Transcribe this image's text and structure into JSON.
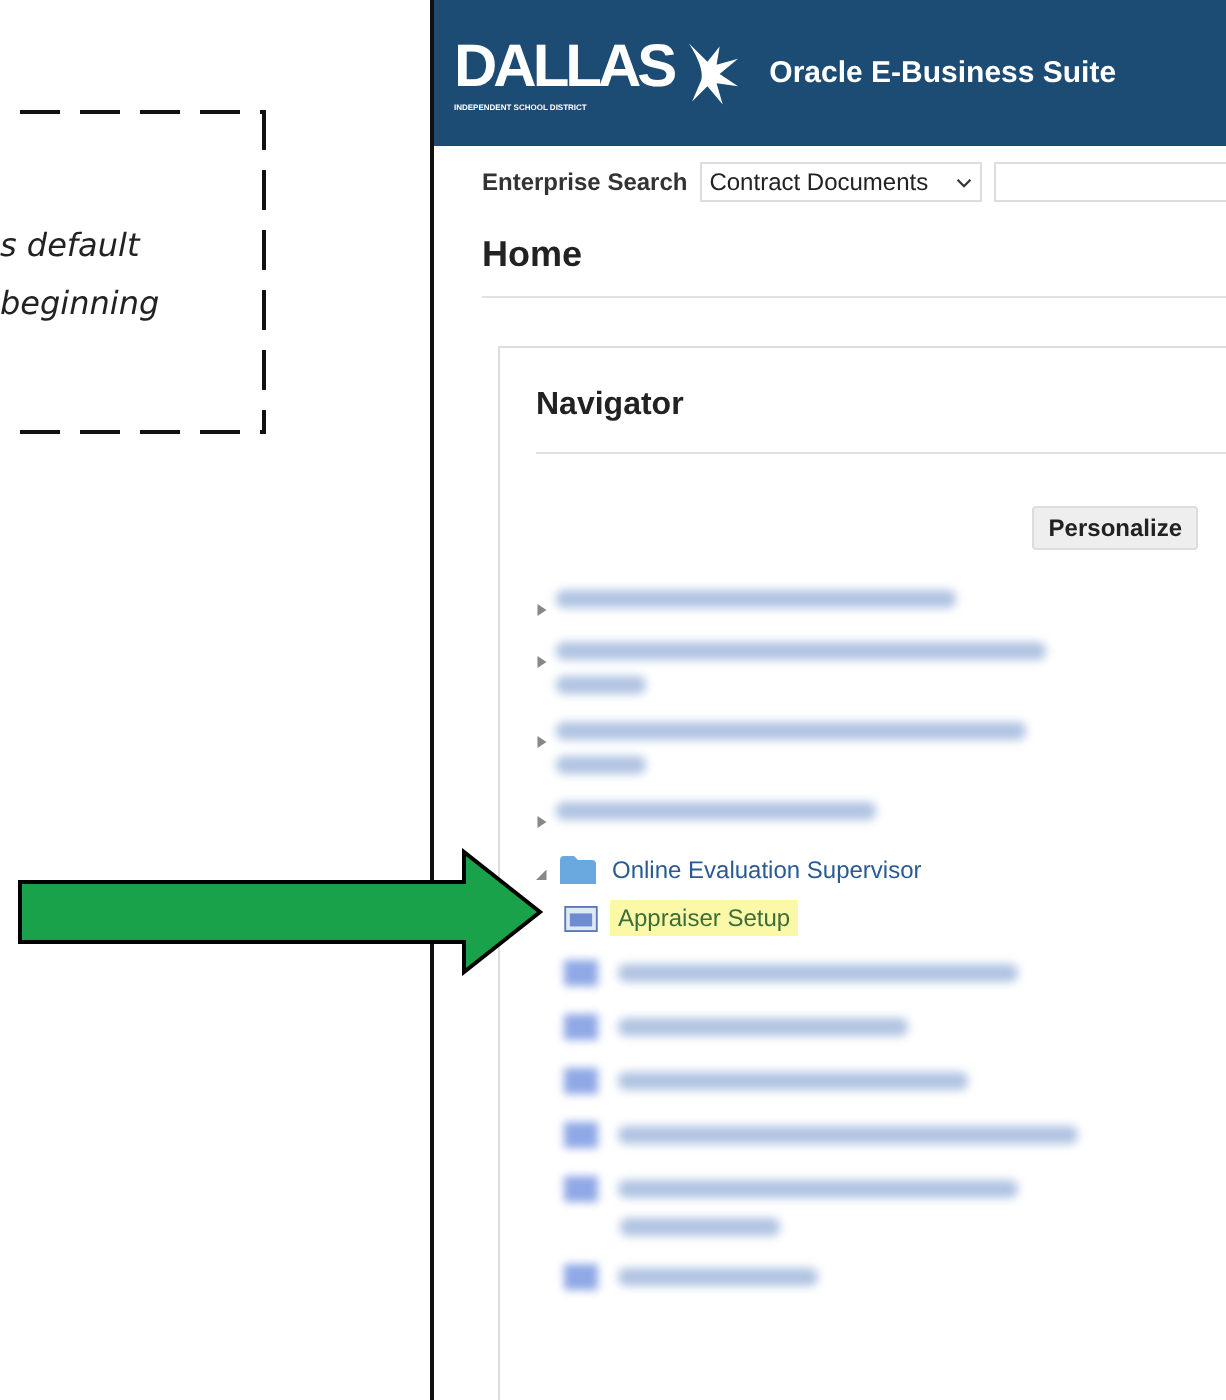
{
  "annotation": {
    "lines": [
      "s default",
      "beginning"
    ]
  },
  "header": {
    "logo": "DALLAS",
    "logo_subtitle": "INDEPENDENT SCHOOL DISTRICT",
    "title": "Oracle E-Business Suite"
  },
  "search": {
    "label": "Enterprise Search",
    "scope": "Contract Documents"
  },
  "page_title": "Home",
  "navigator": {
    "title": "Navigator",
    "personalize": "Personalize",
    "items": [
      {
        "kind": "blurred",
        "wrapped": false,
        "expanded": false
      },
      {
        "kind": "blurred",
        "wrapped": true,
        "expanded": false
      },
      {
        "kind": "blurred",
        "wrapped": true,
        "expanded": false
      },
      {
        "kind": "blurred",
        "wrapped": false,
        "expanded": false
      },
      {
        "kind": "folder",
        "label": "Online Evaluation Supervisor",
        "expanded": true,
        "children": [
          {
            "kind": "page",
            "label": "Appraiser Setup",
            "selected": true
          },
          {
            "kind": "blurred",
            "wrapped": false,
            "selected": false
          },
          {
            "kind": "blurred",
            "wrapped": false,
            "selected": false
          },
          {
            "kind": "blurred",
            "wrapped": false,
            "selected": false
          },
          {
            "kind": "blurred",
            "wrapped": false,
            "selected": false
          },
          {
            "kind": "blurred",
            "wrapped": true,
            "selected": false
          },
          {
            "kind": "blurred",
            "wrapped": false,
            "selected": false
          }
        ]
      }
    ]
  }
}
